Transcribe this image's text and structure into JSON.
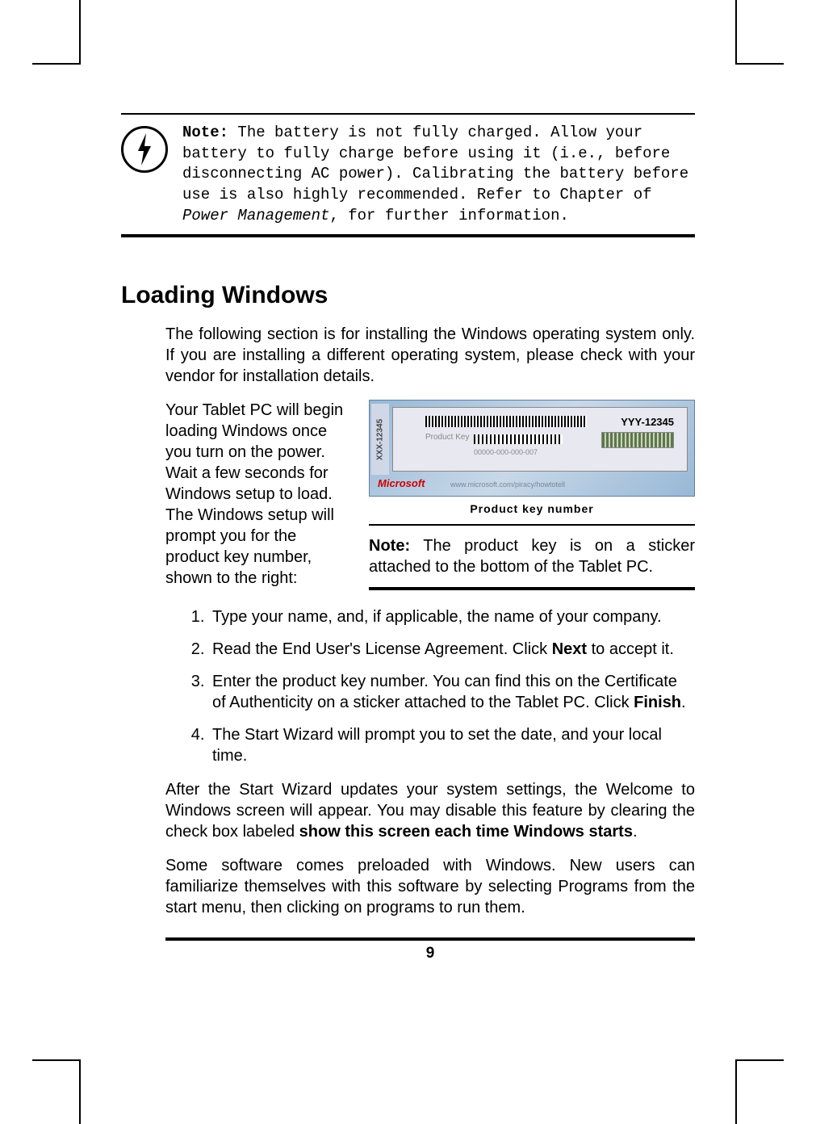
{
  "note_top": {
    "label": "Note:",
    "line1": " The battery is not fully charged. Allow your battery to fully charge before using it (i.e., before disconnecting AC power). Calibrating the battery before use is also highly recommended. Refer to Chapter of ",
    "italic": "Power Management",
    "line2": ", for further information."
  },
  "heading": "Loading Windows",
  "intro": "The following section is for installing the Windows operating system only. If you are installing a different operating system, please check with your vendor for installation details.",
  "left_para": "Your Tablet PC will begin loading Windows once you turn on the power. Wait a few seconds for Windows setup to load. The Windows setup will prompt you for the product key number, shown to the right:",
  "label": {
    "side": "XXX-12345",
    "yyy": "YYY-12345",
    "pk": "Product Key",
    "zeros": "00000-000-000-007",
    "ms": "Microsoft",
    "url": "www.microsoft.com/piracy/howtotell"
  },
  "caption": "Product key number",
  "right_note": {
    "label": "Note:",
    "text": " The product key is on a sticker attached to the bottom of the Tablet PC."
  },
  "steps": {
    "s1": "Type your name, and, if applicable, the name of your company.",
    "s2a": "Read the End User's License Agreement. Click ",
    "s2b": "Next",
    "s2c": " to accept it.",
    "s3a": "Enter the product key number. You can find this on the Certificate of Authenticity on a sticker attached to the Tablet PC. Click ",
    "s3b": "Finish",
    "s3c": ".",
    "s4": "The Start Wizard will prompt you to set the date, and your local time."
  },
  "para2a": "After the Start Wizard updates your system settings, the Welcome to Windows screen will appear. You may disable this feature by clearing the check box labeled ",
  "para2b": "show this screen each time Windows starts",
  "para2c": ".",
  "para3": "Some software comes preloaded with Windows. New users can familiarize themselves with this software by selecting Programs from the start menu, then clicking on programs to run them.",
  "page_number": "9"
}
